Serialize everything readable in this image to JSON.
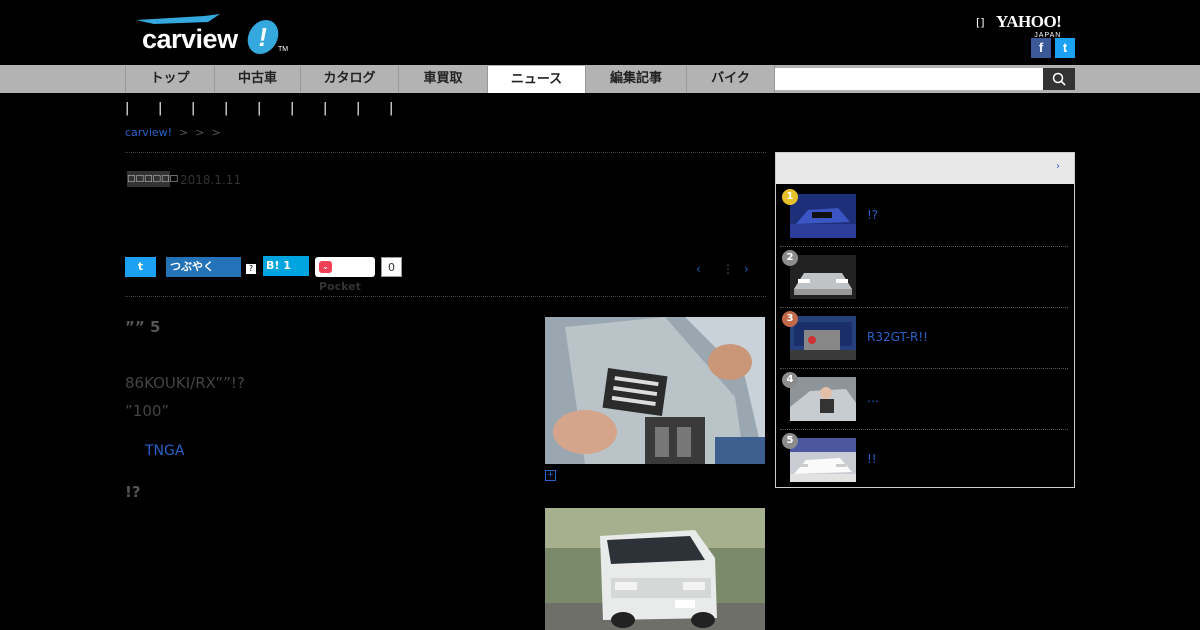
{
  "site": {
    "logo_text": "carview",
    "logo_bang": "!",
    "logo_tm": "TM",
    "header_bracket": "[]",
    "yahoo_main": "YAHOO!",
    "yahoo_sub": "JAPAN",
    "facebook_label": "f",
    "twitter_label": "t"
  },
  "nav": {
    "items": [
      "トップ",
      "中古車",
      "カタログ",
      "車買取",
      "ニュース",
      "編集記事",
      "バイク"
    ],
    "active_index": 4,
    "search_placeholder": ""
  },
  "subnav": {
    "separators": [
      "|",
      "|",
      "|",
      "|",
      "|",
      "|",
      "|",
      "|",
      "|"
    ]
  },
  "breadcrumb": {
    "home": "carview!",
    "sep": ">",
    "trail": [
      "",
      ""
    ]
  },
  "article": {
    "category_badge": "□□□□□□",
    "date": "2018.1.11",
    "share": {
      "tweet_icon": "t",
      "mixi_label": "つぶやく",
      "question_mark": "?",
      "hatena_label": "B!",
      "hatena_count": "1",
      "pocket_label": "Pocket",
      "pocket_count": "0"
    },
    "pager": {
      "prev": "‹",
      "list": "⋮",
      "next": "›"
    },
    "lead": "”” 5",
    "body_line1": "86KOUKI/RX””!?",
    "body_line2": "”100”",
    "tnga_link": "TNGA",
    "exclaim": "!?",
    "zoom_icon": "+"
  },
  "ranking": {
    "more_icon": "›",
    "items": [
      {
        "num": "1",
        "title": "!?",
        "color": "#e8c02c"
      },
      {
        "num": "2",
        "title": "",
        "color": "#8c8c8c"
      },
      {
        "num": "3",
        "title": "R32GT-R!!",
        "color": "#c06a4a"
      },
      {
        "num": "4",
        "title": "…",
        "color": "#8c8c8c"
      },
      {
        "num": "5",
        "title": "!!",
        "color": "#8c8c8c"
      }
    ]
  }
}
